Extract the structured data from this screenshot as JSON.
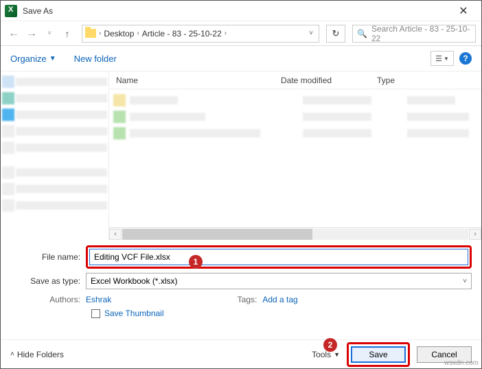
{
  "title": "Save As",
  "breadcrumb": {
    "a": "Desktop",
    "b": "Article - 83 - 25-10-22"
  },
  "search": {
    "placeholder": "Search Article - 83 - 25-10-22"
  },
  "toolbar": {
    "organize": "Organize",
    "newfolder": "New folder"
  },
  "cols": {
    "name": "Name",
    "date": "Date modified",
    "type": "Type"
  },
  "form": {
    "filename_label": "File name:",
    "filename_value": "Editing VCF File.xlsx",
    "type_label": "Save as type:",
    "type_value": "Excel Workbook (*.xlsx)"
  },
  "meta": {
    "authors_label": "Authors:",
    "authors_value": "Eshrak",
    "tags_label": "Tags:",
    "tags_value": "Add a tag"
  },
  "thumbnail": "Save Thumbnail",
  "footer": {
    "hide": "Hide Folders",
    "tools": "Tools",
    "save": "Save",
    "cancel": "Cancel"
  },
  "callouts": {
    "one": "1",
    "two": "2"
  },
  "watermark": "wsxdn.com"
}
